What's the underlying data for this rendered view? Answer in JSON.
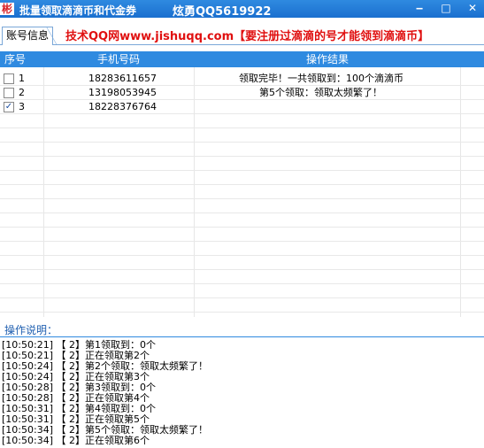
{
  "window": {
    "icon_glyph": "彬",
    "title": "批量领取滴滴币和代金券",
    "author": "炫勇QQ5619922",
    "minimize": "‒",
    "maximize": "□",
    "close": "✕"
  },
  "tabs": {
    "account_info": "账号信息"
  },
  "promo": "技术QQ网www.jishuqq.com【要注册过滴滴的号才能领到滴滴币】",
  "table": {
    "headers": [
      "序号",
      "手机号码",
      "操作结果"
    ],
    "rows": [
      {
        "index": "1",
        "checked": false,
        "phone": "18283611657",
        "result": "领取完毕！一共领取到：100个滴滴币"
      },
      {
        "index": "2",
        "checked": false,
        "phone": "13198053945",
        "result": "第5个领取：领取太频繁了！"
      },
      {
        "index": "3",
        "checked": true,
        "phone": "18228376764",
        "result": ""
      }
    ]
  },
  "log_title": "操作说明：",
  "log_lines": [
    "[10:50:21] 【 2】第1领取到：0个",
    "[10:50:21] 【 2】正在领取第2个",
    "[10:50:24] 【 2】第2个领取：领取太频繁了！",
    "[10:50:24] 【 2】正在领取第3个",
    "[10:50:28] 【 2】第3领取到：0个",
    "[10:50:28] 【 2】正在领取第4个",
    "[10:50:31] 【 2】第4领取到：0个",
    "[10:50:31] 【 2】正在领取第5个",
    "[10:50:34] 【 2】第5个领取：领取太频繁了！",
    "[10:50:34] 【 2】正在领取第6个"
  ],
  "colors": {
    "title_bar": "#1a6fcf",
    "promo_text": "#e01010",
    "header_bg": "#2f8ae0"
  }
}
